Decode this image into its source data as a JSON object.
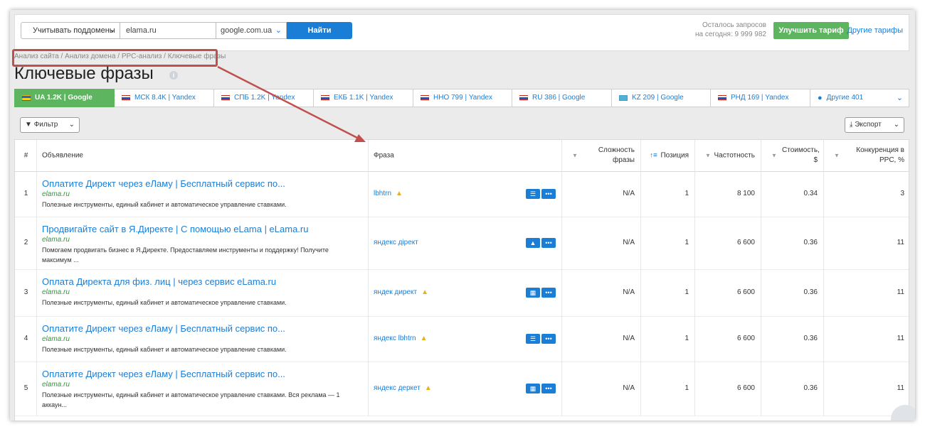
{
  "toolbar": {
    "subdomains_label": "Учитывать поддомены",
    "domain_value": "elama.ru",
    "engine_value": "google.com.ua",
    "find_label": "Найти",
    "remaining_line1": "Осталось запросов",
    "remaining_line2": "на сегодня: 9 999 982",
    "upgrade_label": "Улучшить тариф",
    "other_tariffs_label": "Другие тарифы"
  },
  "breadcrumb": "Анализ сайта / Анализ домена / PPC-анализ / Ключевые фразы",
  "page_title": "Ключевые фразы",
  "tabs": [
    {
      "label": "UA 1.2K | Google",
      "flag": "ua",
      "active": true
    },
    {
      "label": "МСК 8.4K | Yandex",
      "flag": "ru"
    },
    {
      "label": "СПБ 1.2K | Yandex",
      "flag": "ru"
    },
    {
      "label": "ЕКБ 1.1K | Yandex",
      "flag": "ru"
    },
    {
      "label": "ННО 799 | Yandex",
      "flag": "ru"
    },
    {
      "label": "RU 386 | Google",
      "flag": "ru"
    },
    {
      "label": "KZ 209 | Google",
      "flag": "kz"
    },
    {
      "label": "РНД 169 | Yandex",
      "flag": "ru"
    },
    {
      "label": "Другие 401",
      "flag": "globe"
    }
  ],
  "filter_label": "Фильтр",
  "export_label": "Экспорт",
  "table": {
    "headers": {
      "num": "#",
      "ad": "Объявление",
      "phrase": "Фраза",
      "difficulty": "Сложность фразы",
      "position": "Позиция",
      "frequency": "Частотность",
      "cost": "Стоимость, $",
      "competition": "Конкуренция в PPC, %"
    },
    "rows": [
      {
        "num": "1",
        "title": "Оплатите Директ через еЛаму | Бесплатный сервис по...",
        "url": "elama.ru",
        "desc": "Полезные инструменты, единый кабинет и автоматическое управление ставками.",
        "phrase": "lbhtrn",
        "warn": true,
        "btn_icon": "list-icon",
        "difficulty": "N/A",
        "position": "1",
        "frequency": "8 100",
        "cost": "0.34",
        "competition": "3"
      },
      {
        "num": "2",
        "title": "Продвигайте сайт в Я.Директе | С помощью eLama | eLama.ru",
        "url": "elama.ru",
        "desc": "Помогаем продвигать бизнес в Я.Директе. Предоставляем инструменты и поддержку! Получите максимум ...",
        "phrase": "яндекс дірект",
        "warn": false,
        "btn_icon": "graduation-cap-icon",
        "difficulty": "N/A",
        "position": "1",
        "frequency": "6 600",
        "cost": "0.36",
        "competition": "11"
      },
      {
        "num": "3",
        "title": "Оплата Директа для физ. лиц | через сервис eLama.ru",
        "url": "elama.ru",
        "desc": "Полезные инструменты, единый кабинет и автоматическое управление ставками.",
        "phrase": "яндек директ",
        "warn": true,
        "btn_icon": "news-icon",
        "difficulty": "N/A",
        "position": "1",
        "frequency": "6 600",
        "cost": "0.36",
        "competition": "11"
      },
      {
        "num": "4",
        "title": "Оплатите Директ через еЛаму | Бесплатный сервис по...",
        "url": "elama.ru",
        "desc": "Полезные инструменты, единый кабинет и автоматическое управление ставками.",
        "phrase": "яндекс lbhtrn",
        "warn": true,
        "btn_icon": "list-icon",
        "difficulty": "N/A",
        "position": "1",
        "frequency": "6 600",
        "cost": "0.36",
        "competition": "11"
      },
      {
        "num": "5",
        "title": "Оплатите Директ через еЛаму | Бесплатный сервис по...",
        "url": "elama.ru",
        "desc": "Полезные инструменты, единый кабинет и автоматическое управление ставками. Вся реклама — 1 аккаун...",
        "phrase": "яндекс деркет",
        "warn": true,
        "btn_icon": "news-icon",
        "difficulty": "N/A",
        "position": "1",
        "frequency": "6 600",
        "cost": "0.36",
        "competition": "11"
      }
    ]
  },
  "colors": {
    "accent": "#1b7ed6",
    "green": "#5db560",
    "highlight": "#c0504d"
  }
}
